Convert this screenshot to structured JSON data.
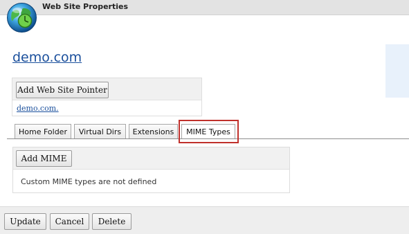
{
  "window": {
    "title": "Web Site Properties",
    "icon": "globe-icon"
  },
  "site": {
    "name": "demo.com"
  },
  "pointers": {
    "add_label": "Add Web Site Pointer",
    "items": [
      "demo.com."
    ]
  },
  "tabs": [
    {
      "label": "Home Folder"
    },
    {
      "label": "Virtual Dirs"
    },
    {
      "label": "Extensions"
    },
    {
      "label": "MIME Types",
      "active": true
    }
  ],
  "mime": {
    "add_label": "Add MIME",
    "empty_message": "Custom MIME types are not defined"
  },
  "footer": {
    "update_label": "Update",
    "cancel_label": "Cancel",
    "delete_label": "Delete"
  },
  "colors": {
    "link": "#1a4f9c",
    "highlight": "#c0302b"
  }
}
